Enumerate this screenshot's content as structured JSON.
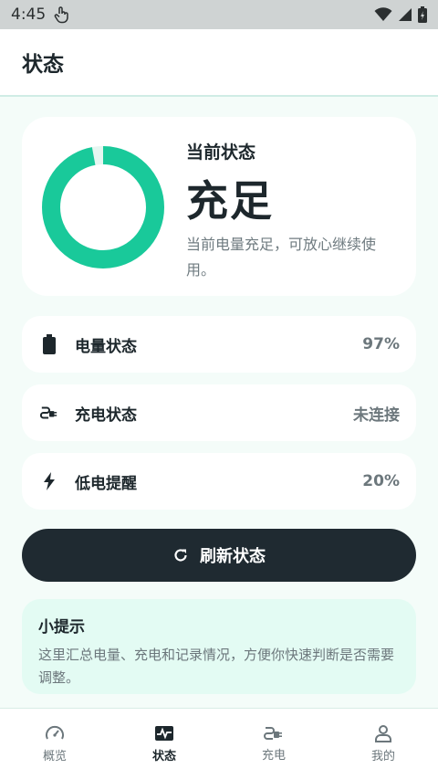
{
  "status_bar": {
    "time": "4:45"
  },
  "app_bar": {
    "title": "状态"
  },
  "hero": {
    "label": "当前状态",
    "state": "充足",
    "description": "当前电量充足，可放心继续使用。",
    "ring_percent": 97,
    "ring_color": "#19c99a"
  },
  "rows": [
    {
      "icon": "battery-icon",
      "label": "电量状态",
      "value": "97%"
    },
    {
      "icon": "plug-icon",
      "label": "充电状态",
      "value": "未连接"
    },
    {
      "icon": "bolt-icon",
      "label": "低电提醒",
      "value": "20%"
    }
  ],
  "refresh_button": {
    "label": "刷新状态"
  },
  "tip": {
    "title": "小提示",
    "text": "这里汇总电量、充电和记录情况，方便你快速判断是否需要调整。"
  },
  "nav": [
    {
      "icon": "gauge-icon",
      "label": "概览",
      "active": false
    },
    {
      "icon": "pulse-icon",
      "label": "状态",
      "active": true
    },
    {
      "icon": "plug-icon",
      "label": "充电",
      "active": false
    },
    {
      "icon": "person-icon",
      "label": "我的",
      "active": false
    }
  ]
}
